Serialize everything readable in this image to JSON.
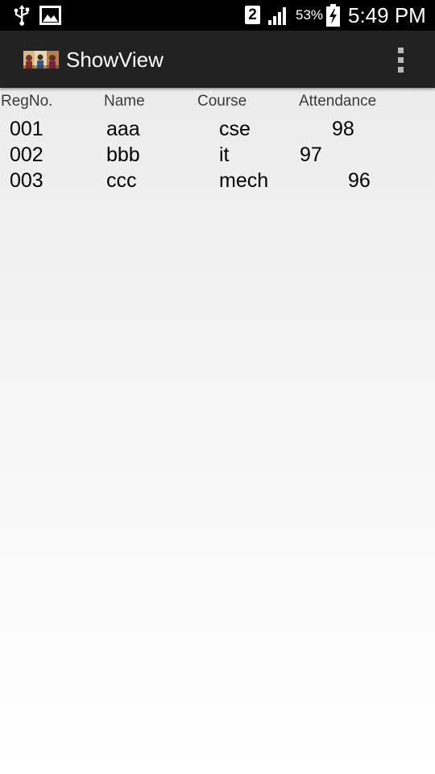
{
  "status_bar": {
    "icons": [
      "usb-icon",
      "image-icon",
      "sim-icon",
      "signal-icon",
      "battery-icon"
    ],
    "sim_slot": "2",
    "battery_percent": "53%",
    "time": "5:49 PM"
  },
  "action_bar": {
    "app_icon": "app-thumbnail-icon",
    "title": "ShowView",
    "menu_icon": "overflow-menu-icon"
  },
  "table": {
    "headers": [
      "RegNo.",
      "Name",
      "Course",
      "Attendance"
    ],
    "rows": [
      {
        "regno": "001",
        "name": "aaa",
        "course": "cse",
        "attendance": "98"
      },
      {
        "regno": "002",
        "name": "bbb",
        "course": "it",
        "attendance": "97"
      },
      {
        "regno": "003",
        "name": "ccc",
        "course": "mech",
        "attendance": "96"
      }
    ]
  },
  "colors": {
    "status_bar_bg": "#000000",
    "action_bar_bg": "#222222",
    "header_text": "#3a3a3a",
    "cell_text": "#000000"
  }
}
